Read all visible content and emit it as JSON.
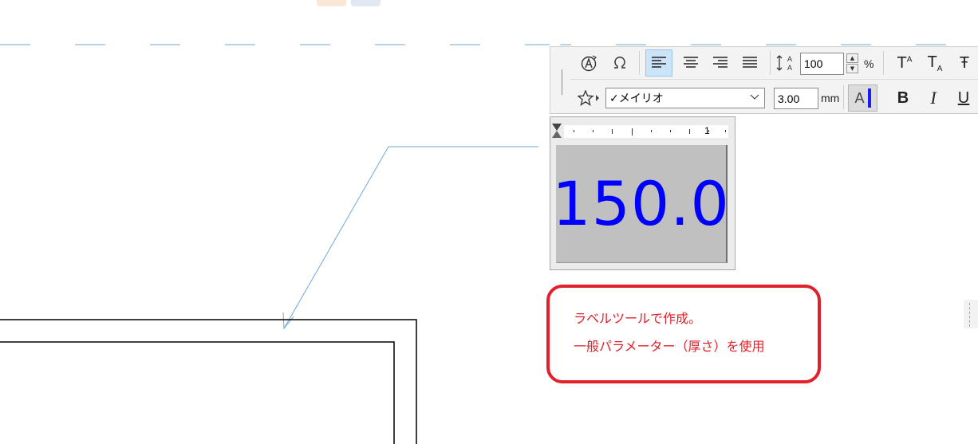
{
  "toolbar": {
    "line_spacing_value": "100",
    "line_spacing_unit": "%",
    "font_name": "✓メイリオ",
    "text_size_value": "3.00",
    "text_size_unit": "mm",
    "color_label": "A",
    "bold_label": "B",
    "italic_label": "I",
    "underline_label": "U",
    "superscript_label": "TA",
    "subscript_label": "TA",
    "strikethrough_label": "Ŧ",
    "accent_color": "#cce4f7"
  },
  "preview": {
    "ruler_number": "1",
    "label_value": "150.0",
    "value_color": "#0000ff"
  },
  "note": {
    "line1": "ラベルツールで作成。",
    "line2": "一般パラメーター（厚さ）を使用",
    "border_color": "#e0202a"
  }
}
